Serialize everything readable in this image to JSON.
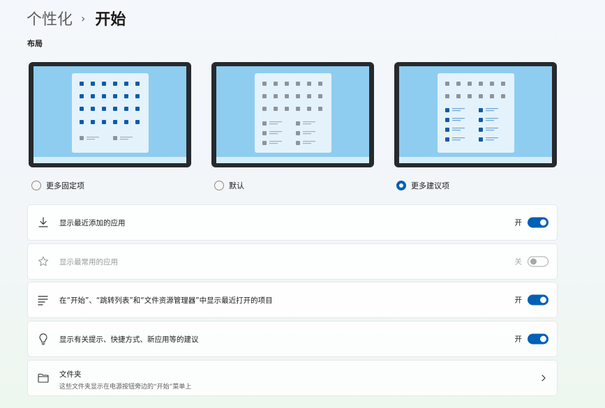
{
  "breadcrumb": {
    "parent": "个性化",
    "separator": "›",
    "current": "开始"
  },
  "layout_section": {
    "title": "布局"
  },
  "layout_options": [
    {
      "label": "更多固定项",
      "selected": false
    },
    {
      "label": "默认",
      "selected": false
    },
    {
      "label": "更多建议项",
      "selected": true
    }
  ],
  "settings": {
    "recent_apps": {
      "label": "显示最近添加的应用",
      "state": "开",
      "on": true,
      "icon": "download-icon"
    },
    "most_used": {
      "label": "显示最常用的应用",
      "state": "关",
      "on": false,
      "disabled": true,
      "icon": "star-icon"
    },
    "recent_items": {
      "label": "在“开始”、“跳转列表”和“文件资源管理器”中显示最近打开的项目",
      "state": "开",
      "on": true,
      "icon": "list-icon"
    },
    "tips": {
      "label": "显示有关提示、快捷方式、新应用等的建议",
      "state": "开",
      "on": true,
      "icon": "lightbulb-icon"
    },
    "folders": {
      "title": "文件夹",
      "subtitle": "这些文件夹显示在电源按钮旁边的“开始”菜单上",
      "icon": "folder-icon"
    }
  },
  "colors": {
    "accent": "#005fb8",
    "preview_bg": "#8ecdf0",
    "card_frame": "#262a2e"
  }
}
